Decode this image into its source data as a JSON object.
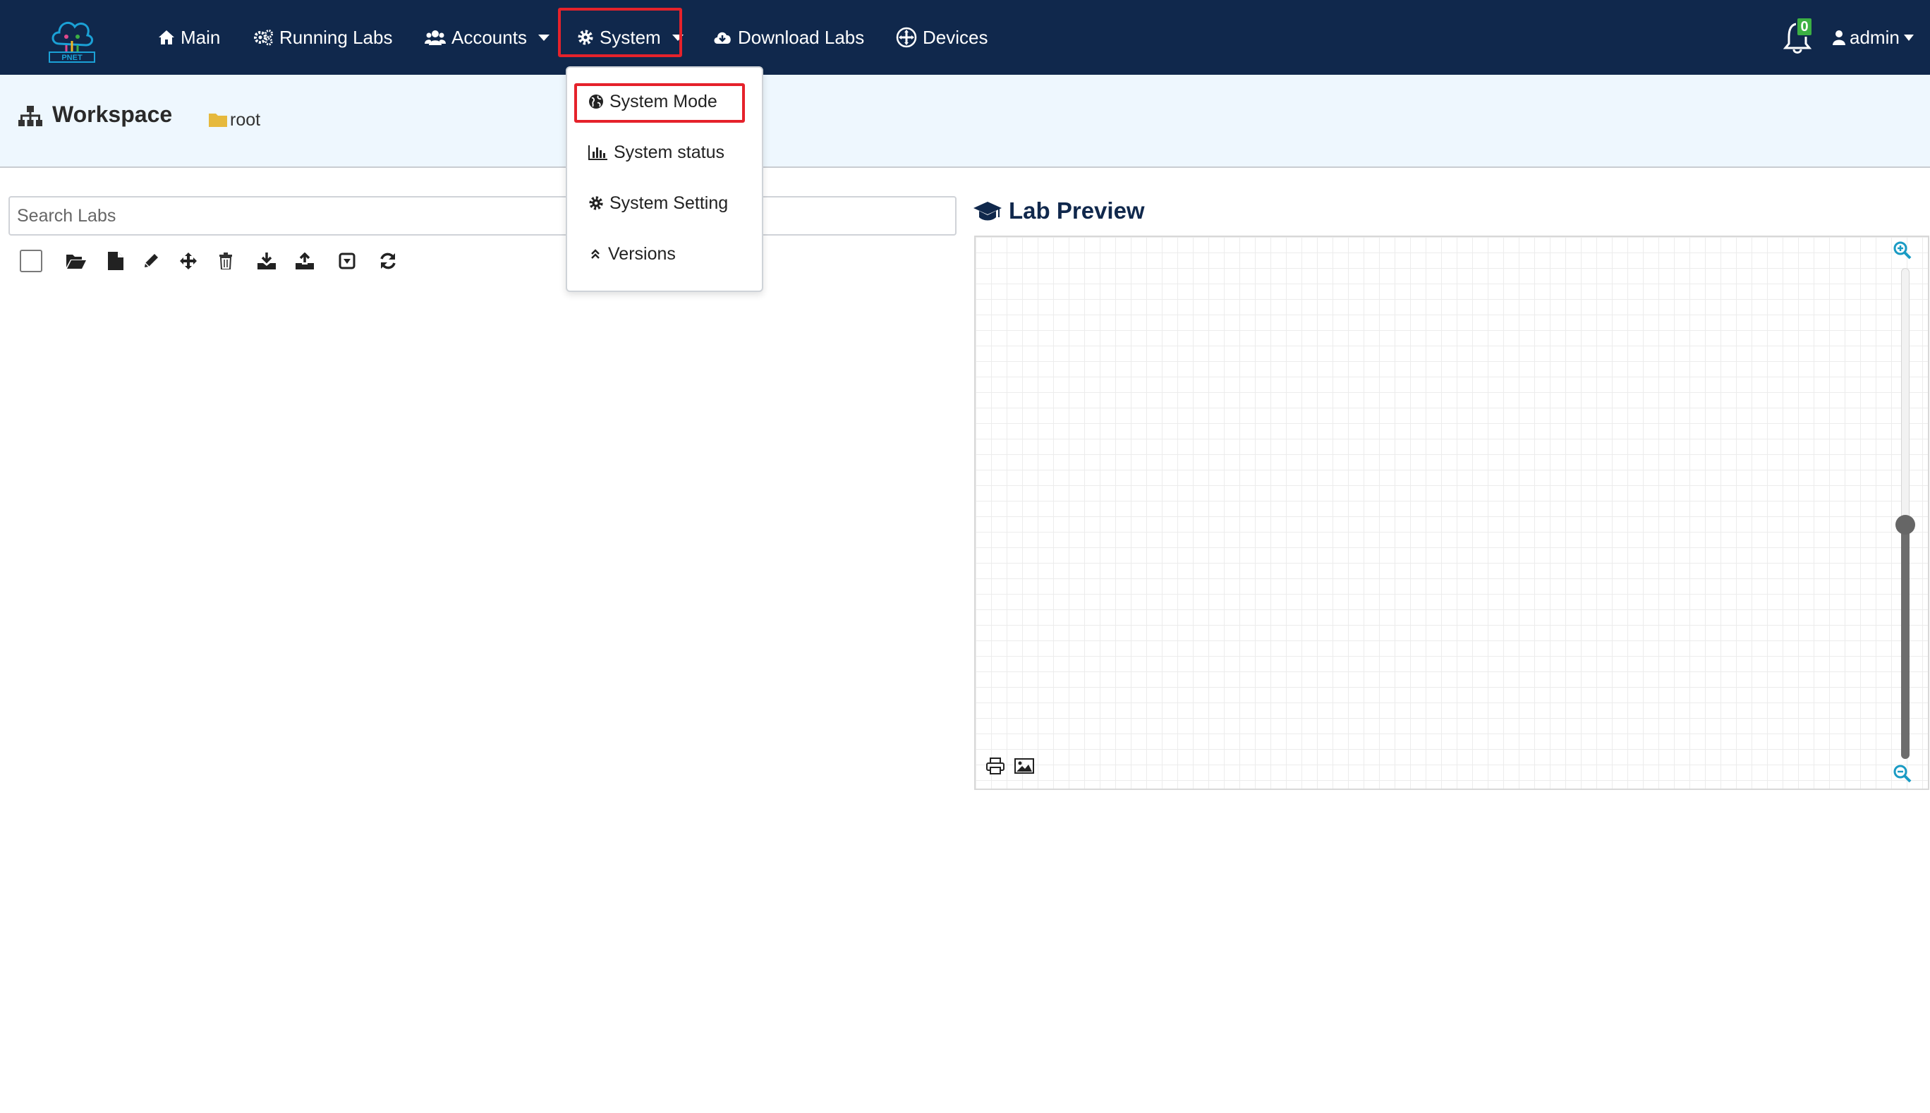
{
  "navbar": {
    "logo_text": "PNET",
    "items": [
      {
        "label": "Main",
        "icon": "home-icon"
      },
      {
        "label": "Running Labs",
        "icon": "gears-icon"
      },
      {
        "label": "Accounts",
        "icon": "users-icon"
      },
      {
        "label": "System",
        "icon": "gear-icon"
      },
      {
        "label": "Download Labs",
        "icon": "cloud-download-icon"
      },
      {
        "label": "Devices",
        "icon": "plus-circle-icon"
      }
    ],
    "notification_count": "0",
    "user_label": "admin"
  },
  "system_menu": {
    "items": [
      {
        "label": "System Mode",
        "icon": "globe-icon"
      },
      {
        "label": "System status",
        "icon": "bar-chart-icon"
      },
      {
        "label": "System Setting",
        "icon": "gear-icon"
      },
      {
        "label": "Versions",
        "icon": "double-up-icon"
      }
    ]
  },
  "workspace": {
    "title": "Workspace",
    "folder": "root"
  },
  "search": {
    "placeholder": "Search Labs"
  },
  "toolbar": {
    "icons": [
      "select-all-checkbox",
      "open-folder-icon",
      "new-file-icon",
      "pencil-icon",
      "move-icon",
      "trash-icon",
      "download-icon",
      "upload-icon",
      "export-icon",
      "refresh-icon"
    ]
  },
  "lab_preview": {
    "title": "Lab Preview",
    "zoom_level": 0.48
  },
  "colors": {
    "navbar_bg": "#10284c",
    "header_bg": "#eef7fe",
    "highlight": "#e5222b",
    "badge": "#3cb043",
    "folder": "#e6b93d",
    "zoom_icon": "#1a9bc4"
  }
}
